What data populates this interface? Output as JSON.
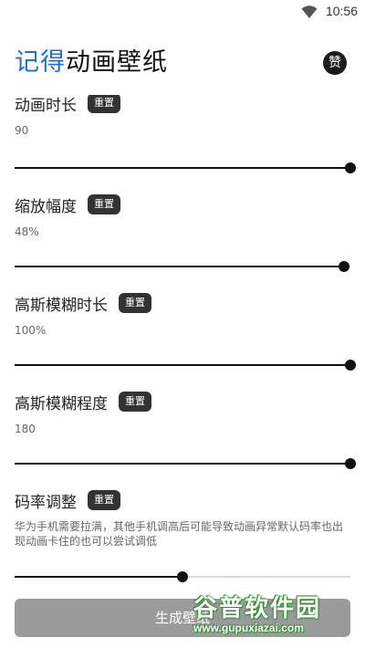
{
  "status_bar": {
    "time": "10:56"
  },
  "header": {
    "title_accent": "记得",
    "title_rest": "动画壁纸",
    "like_badge": "赞"
  },
  "settings": [
    {
      "label": "动画时长",
      "reset": "重置",
      "value": "90",
      "slider_fraction": 1.0
    },
    {
      "label": "缩放幅度",
      "reset": "重置",
      "value": "48%",
      "slider_fraction": 0.98
    },
    {
      "label": "高斯模糊时长",
      "reset": "重置",
      "value": "100%",
      "slider_fraction": 1.0
    },
    {
      "label": "高斯模糊程度",
      "reset": "重置",
      "value": "180",
      "slider_fraction": 1.0
    },
    {
      "label": "码率调整",
      "reset": "重置",
      "description": "华为手机需要拉满，其他手机调高后可能导致动画异常默认码率也出现动画卡住的也可以尝试调低",
      "slider_fraction": 0.5
    }
  ],
  "generate_button": {
    "label": "生成壁纸"
  },
  "watermark": {
    "text": "谷普软件园",
    "url": "www.gupuxiazai.com"
  },
  "colors": {
    "accent": "#1f6fd0",
    "slider_active": "#111111",
    "slider_inactive": "#d8d8d8",
    "button_disabled": "#9a9a9a"
  }
}
